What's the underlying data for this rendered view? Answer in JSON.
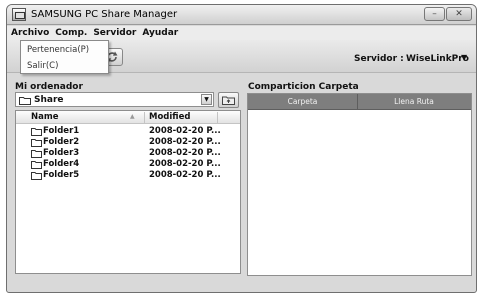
{
  "window": {
    "title": "SAMSUNG PC Share Manager",
    "minimize_symbol": "–",
    "close_symbol": "✕"
  },
  "menubar": {
    "items": [
      {
        "label": "Archivo"
      },
      {
        "label": "Comp."
      },
      {
        "label": "Servidor"
      },
      {
        "label": "Ayudar"
      }
    ]
  },
  "dropdown": {
    "items": [
      {
        "label": "Pertenencia(P)"
      },
      {
        "label": "Salir(C)"
      }
    ]
  },
  "toolbar": {
    "server_label": "Servidor :",
    "server_value": "WiseLinkPro",
    "refresh_icon": "refresh-icon"
  },
  "left_panel": {
    "title": "Mi ordenador",
    "folder_select_value": "Share",
    "columns": {
      "name": "Name",
      "modified": "Modified"
    },
    "rows": [
      {
        "name": "Folder1",
        "modified": "2008-02-20 P..."
      },
      {
        "name": "Folder2",
        "modified": "2008-02-20 P..."
      },
      {
        "name": "Folder3",
        "modified": "2008-02-20 P..."
      },
      {
        "name": "Folder4",
        "modified": "2008-02-20 P..."
      },
      {
        "name": "Folder5",
        "modified": "2008-02-20 P..."
      }
    ]
  },
  "right_panel": {
    "title": "Comparticion Carpeta",
    "columns": {
      "carpeta": "Carpeta",
      "ruta": "Llena Ruta"
    }
  },
  "colors": {
    "window_bg": "#d9d9d9",
    "share_header_bg": "#7e7e7e"
  }
}
